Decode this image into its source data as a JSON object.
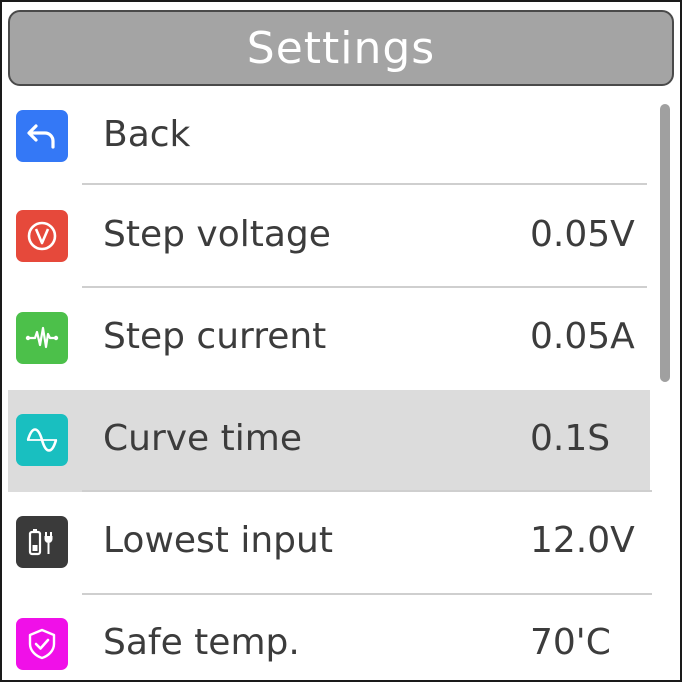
{
  "header": {
    "title": "Settings"
  },
  "menu": {
    "items": [
      {
        "label": "Back",
        "value": "",
        "icon": "back-arrow-icon",
        "icon_color": "#3478f6"
      },
      {
        "label": "Step voltage",
        "value": "0.05V",
        "icon": "voltage-icon",
        "icon_color": "#e6493b"
      },
      {
        "label": "Step current",
        "value": "0.05A",
        "icon": "current-waveform-icon",
        "icon_color": "#4cc04a"
      },
      {
        "label": "Curve time",
        "value": "0.1S",
        "icon": "sine-wave-icon",
        "icon_color": "#19bfc0",
        "selected": true
      },
      {
        "label": "Lowest input",
        "value": "12.0V",
        "icon": "battery-plug-icon",
        "icon_color": "#3a3a3a"
      },
      {
        "label": "Safe temp.",
        "value": "70'C",
        "icon": "shield-check-icon",
        "icon_color": "#f010e8"
      }
    ]
  },
  "scrollbar": {
    "visible_fraction": 0.49,
    "position": 0.0
  },
  "colors": {
    "title_bar": "#a4a4a4",
    "selected_row": "#dcdcdc",
    "text": "#3c3c3c"
  }
}
